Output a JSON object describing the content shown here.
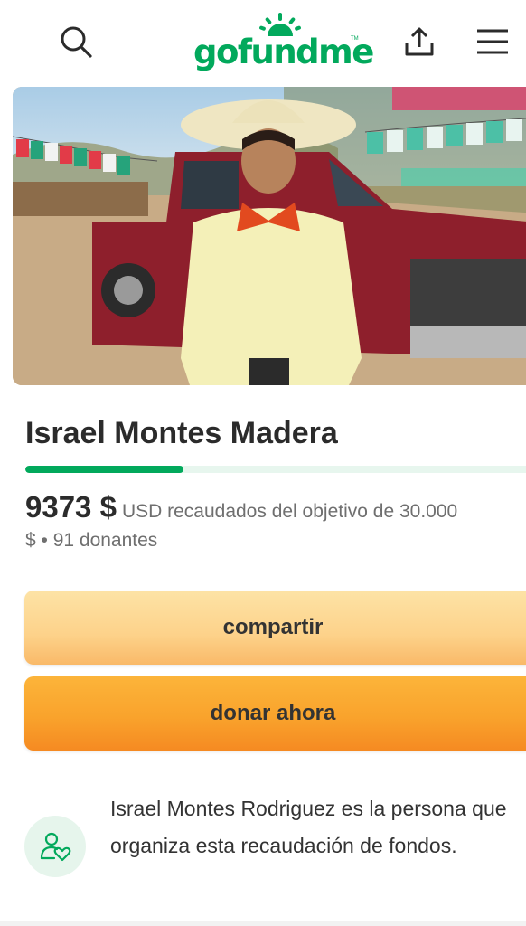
{
  "header": {
    "logo_text": "gofundme",
    "logo_tm": "TM",
    "icons": [
      "search-icon",
      "share-upload-icon",
      "hamburger-menu-icon"
    ]
  },
  "campaign": {
    "title": "Israel Montes Madera",
    "progress_fraction": 0.3124,
    "raised_amount": "9373 $",
    "raised_rest": "USD recaudados del objetivo de 30.000",
    "donors_line": "$ • 91 donantes"
  },
  "actions": {
    "share_label": "compartir",
    "donate_label": "donar ahora"
  },
  "organizer": {
    "icon": "user-heart-icon",
    "text": "Israel Montes Rodriguez es la persona que organiza esta recaudación de fondos."
  },
  "colors": {
    "brand_green": "#02a95c",
    "share_button": "#fdd28a",
    "donate_button": "#f9a32c",
    "avatar_bg": "#e6f5ec"
  }
}
